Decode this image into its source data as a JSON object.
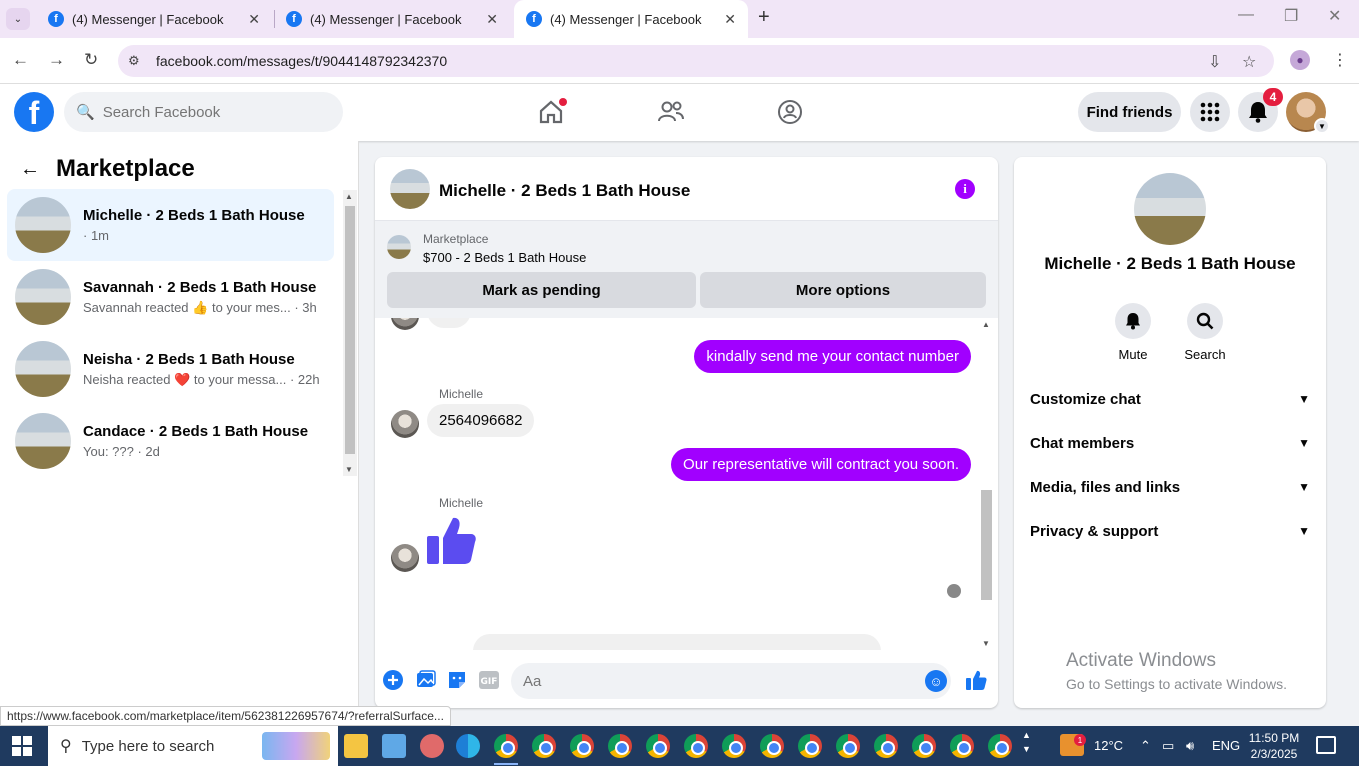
{
  "browser": {
    "tabs": [
      {
        "title": "(4) Messenger | Facebook"
      },
      {
        "title": "(4) Messenger | Facebook"
      },
      {
        "title": "(4) Messenger | Facebook"
      }
    ],
    "url": "facebook.com/messages/t/9044148792342370",
    "status_link": "https://www.facebook.com/marketplace/item/562381226957674/?referralSurface..."
  },
  "fbnav": {
    "search_placeholder": "Search Facebook",
    "find_friends": "Find friends",
    "notif_count": "4"
  },
  "sidebar": {
    "title": "Marketplace",
    "conversations": [
      {
        "name": "Michelle · 2 Beds 1 Bath House",
        "sub": "· 1m"
      },
      {
        "name": "Savannah · 2 Beds 1 Bath House",
        "sub_pre": "Savannah reacted",
        "emoji": "👍",
        "sub_post": "to your mes... · 3h"
      },
      {
        "name": "Neisha · 2 Beds 1 Bath House",
        "sub_pre": "Neisha reacted",
        "emoji": "❤️",
        "sub_post": "to your messa... · 22h"
      },
      {
        "name": "Candace · 2 Beds 1 Bath House",
        "sub": "You: ??? · 2d"
      }
    ]
  },
  "chat": {
    "title": "Michelle · 2 Beds 1 Bath House",
    "marketplace_label": "Marketplace",
    "listing": "$700 - 2 Beds 1 Bath House",
    "mark_pending": "Mark as pending",
    "more_options": "More options",
    "messages": [
      {
        "from": "me",
        "text": "kindally send me your contact number"
      },
      {
        "from": "Michelle",
        "sender": "Michelle",
        "text": "2564096682"
      },
      {
        "from": "me",
        "text": "Our representative will contract you soon."
      },
      {
        "from": "Michelle",
        "sender": "Michelle",
        "text": "👍"
      }
    ],
    "composer_placeholder": "Aa"
  },
  "rpanel": {
    "name": "Michelle · 2 Beds 1 Bath House",
    "mute": "Mute",
    "search": "Search",
    "rows": [
      "Customize chat",
      "Chat members",
      "Media, files and links",
      "Privacy & support"
    ]
  },
  "windows": {
    "activate_title": "Activate Windows",
    "activate_sub": "Go to Settings to activate Windows."
  },
  "taskbar": {
    "search_placeholder": "Type here to search",
    "temperature": "12°C",
    "lang": "ENG",
    "time": "11:50 PM",
    "date": "2/3/2025",
    "weather_badge": "1"
  },
  "colors": {
    "fb_blue": "#1877f2",
    "messenger_purple": "#a100ff",
    "notification_red": "#e41e3f"
  }
}
